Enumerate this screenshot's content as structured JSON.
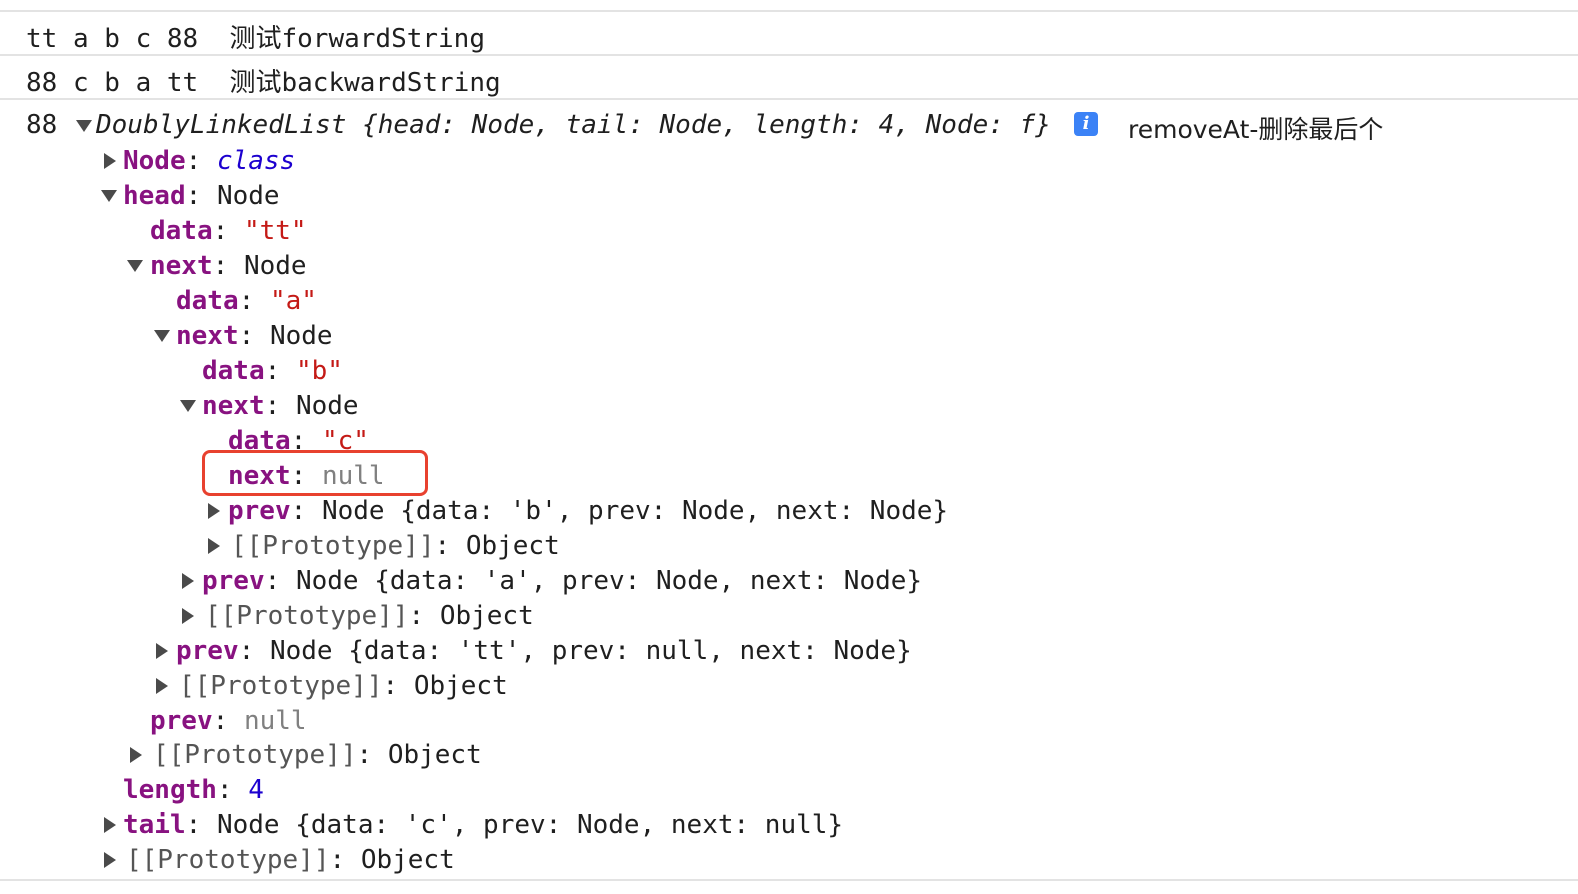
{
  "log_rows": [
    {
      "value": "tt a b c 88",
      "label": "测试forwardString"
    },
    {
      "value": "88 c b a tt",
      "label": "测试backwardString"
    }
  ],
  "object_entry": {
    "prefix": "88",
    "summary": "DoublyLinkedList {head: Node, tail: Node, length: 4, Node: f}",
    "message": "removeAt-删除最后个",
    "info_icon": "info-icon",
    "tree": {
      "node_class": {
        "key": "Node",
        "value": "class"
      },
      "head": {
        "key": "head",
        "value": "Node"
      },
      "head_data": {
        "key": "data",
        "value": "\"tt\""
      },
      "next1": {
        "key": "next",
        "value": "Node"
      },
      "next1_data": {
        "key": "data",
        "value": "\"a\""
      },
      "next2": {
        "key": "next",
        "value": "Node"
      },
      "next2_data": {
        "key": "data",
        "value": "\"b\""
      },
      "next3": {
        "key": "next",
        "value": "Node"
      },
      "next3_data": {
        "key": "data",
        "value": "\"c\""
      },
      "next3_next": {
        "key": "next",
        "value": "null"
      },
      "next3_prev": {
        "key": "prev",
        "value": "Node {data: 'b', prev: Node, next: Node}"
      },
      "next3_proto": {
        "key": "[[Prototype]]",
        "value": "Object"
      },
      "next2_prev": {
        "key": "prev",
        "value": "Node {data: 'a', prev: Node, next: Node}"
      },
      "next2_proto": {
        "key": "[[Prototype]]",
        "value": "Object"
      },
      "next1_prev": {
        "key": "prev",
        "value": "Node {data: 'tt', prev: null, next: Node}"
      },
      "next1_proto": {
        "key": "[[Prototype]]",
        "value": "Object"
      },
      "head_prev": {
        "key": "prev",
        "value": "null"
      },
      "head_proto": {
        "key": "[[Prototype]]",
        "value": "Object"
      },
      "length": {
        "key": "length",
        "value": "4"
      },
      "tail": {
        "key": "tail",
        "value": "Node {data: 'c', prev: Node, next: null}"
      },
      "root_proto": {
        "key": "[[Prototype]]",
        "value": "Object"
      }
    }
  },
  "colors": {
    "key": "#881280",
    "string": "#c41a16",
    "number": "#1c00cf",
    "null": "#808080",
    "highlight": "#e8412f",
    "info_badge": "#3b82f6"
  }
}
